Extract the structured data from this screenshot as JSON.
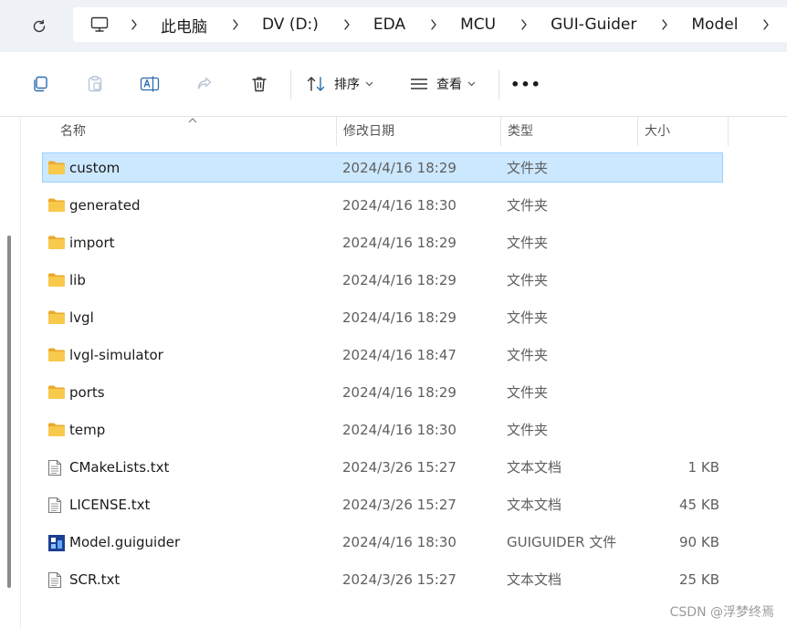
{
  "breadcrumbs": [
    "此电脑",
    "DV (D:)",
    "EDA",
    "MCU",
    "GUI-Guider",
    "Model"
  ],
  "toolbar": {
    "sort_label": "排序",
    "view_label": "查看",
    "more_label": "•••"
  },
  "columns": {
    "name": "名称",
    "date": "修改日期",
    "type": "类型",
    "size": "大小"
  },
  "files": [
    {
      "name": "custom",
      "date": "2024/4/16 18:29",
      "type": "文件夹",
      "size": "",
      "icon": "folder-icon",
      "selected": true
    },
    {
      "name": "generated",
      "date": "2024/4/16 18:30",
      "type": "文件夹",
      "size": "",
      "icon": "folder-icon"
    },
    {
      "name": "import",
      "date": "2024/4/16 18:29",
      "type": "文件夹",
      "size": "",
      "icon": "folder-icon"
    },
    {
      "name": "lib",
      "date": "2024/4/16 18:29",
      "type": "文件夹",
      "size": "",
      "icon": "folder-icon"
    },
    {
      "name": "lvgl",
      "date": "2024/4/16 18:29",
      "type": "文件夹",
      "size": "",
      "icon": "folder-icon"
    },
    {
      "name": "lvgl-simulator",
      "date": "2024/4/16 18:47",
      "type": "文件夹",
      "size": "",
      "icon": "folder-icon"
    },
    {
      "name": "ports",
      "date": "2024/4/16 18:29",
      "type": "文件夹",
      "size": "",
      "icon": "folder-icon"
    },
    {
      "name": "temp",
      "date": "2024/4/16 18:30",
      "type": "文件夹",
      "size": "",
      "icon": "folder-icon"
    },
    {
      "name": "CMakeLists.txt",
      "date": "2024/3/26 15:27",
      "type": "文本文档",
      "size": "1 KB",
      "icon": "text-file-icon"
    },
    {
      "name": "LICENSE.txt",
      "date": "2024/3/26 15:27",
      "type": "文本文档",
      "size": "45 KB",
      "icon": "text-file-icon"
    },
    {
      "name": "Model.guiguider",
      "date": "2024/4/16 18:30",
      "type": "GUIGUIDER 文件",
      "size": "90 KB",
      "icon": "guiguider-file-icon"
    },
    {
      "name": "SCR.txt",
      "date": "2024/3/26 15:27",
      "type": "文本文档",
      "size": "25 KB",
      "icon": "text-file-icon"
    }
  ],
  "watermark": "CSDN @浮梦终焉",
  "colors": {
    "selection_bg": "#cce8ff",
    "selection_border": "#99d1ff",
    "folder": "#f8c94b",
    "address_bg": "#eef2f7"
  }
}
